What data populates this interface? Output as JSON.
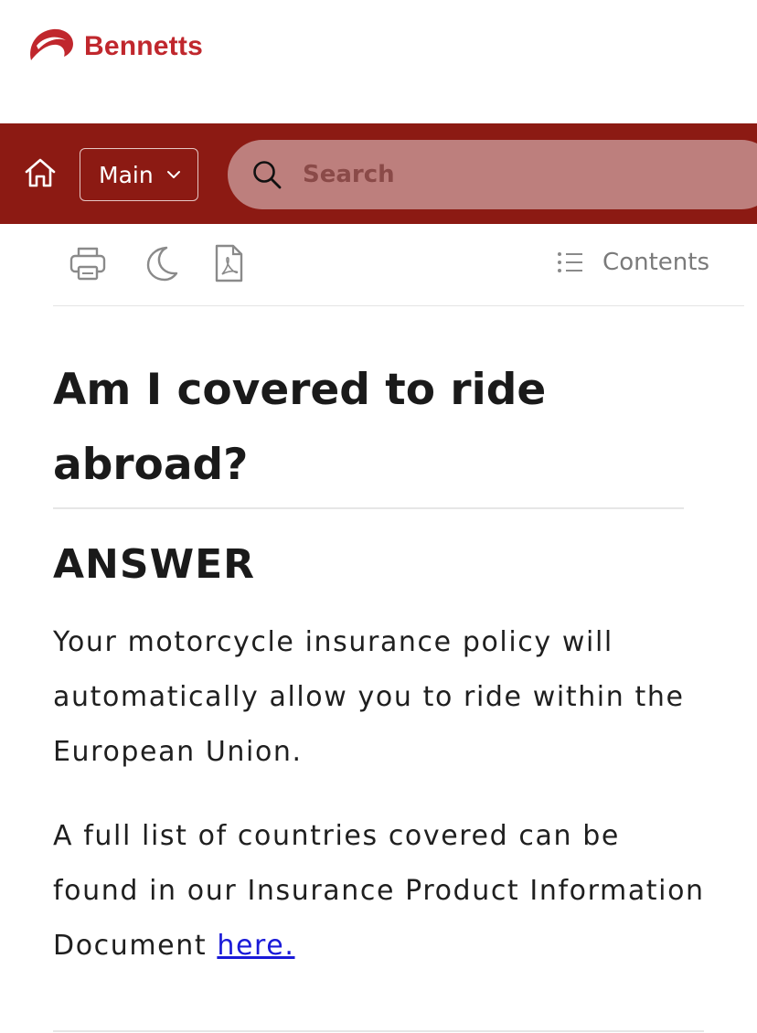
{
  "brand": {
    "name": "Bennetts",
    "color": "#c0272d"
  },
  "navbar": {
    "background": "#8c1a13",
    "home_icon": "home-icon",
    "menu_select_value": "Main",
    "search_placeholder": "Search"
  },
  "toolbar": {
    "icons": [
      "print-icon",
      "dark-mode-moon-icon",
      "pdf-icon"
    ],
    "contents_label": "Contents"
  },
  "article": {
    "title": "Am I covered to ride abroad?",
    "answer_heading": "ANSWER",
    "paragraph1": "Your motorcycle insurance policy will automatically allow you to ride within the European Union.",
    "paragraph2_text": "A full list of countries covered can be found in our Insurance Product Information Document ",
    "paragraph2_link": "here."
  }
}
